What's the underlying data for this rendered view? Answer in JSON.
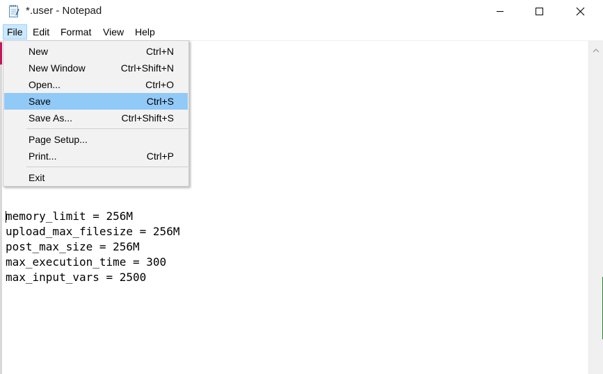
{
  "window": {
    "title": "*.user - Notepad"
  },
  "menubar": {
    "items": [
      {
        "label": "File"
      },
      {
        "label": "Edit"
      },
      {
        "label": "Format"
      },
      {
        "label": "View"
      },
      {
        "label": "Help"
      }
    ]
  },
  "file_menu": {
    "items": [
      {
        "label": "New",
        "shortcut": "Ctrl+N"
      },
      {
        "label": "New Window",
        "shortcut": "Ctrl+Shift+N"
      },
      {
        "label": "Open...",
        "shortcut": "Ctrl+O"
      },
      {
        "label": "Save",
        "shortcut": "Ctrl+S"
      },
      {
        "label": "Save As...",
        "shortcut": "Ctrl+Shift+S"
      },
      {
        "label": "Page Setup...",
        "shortcut": ""
      },
      {
        "label": "Print...",
        "shortcut": "Ctrl+P"
      },
      {
        "label": "Exit",
        "shortcut": ""
      }
    ],
    "highlighted": "Save"
  },
  "editor": {
    "content": "memory_limit = 256M\nupload_max_filesize = 256M\npost_max_size = 256M\nmax_execution_time = 300\nmax_input_vars = 2500"
  },
  "colors": {
    "menu_highlight": "#91c9f7",
    "menubar_active": "#cce8ff"
  },
  "icons": {
    "app": "notepad-icon",
    "minimize": "minimize-icon",
    "maximize": "maximize-icon",
    "close": "close-icon",
    "scroll_up": "chevron-up-icon"
  }
}
